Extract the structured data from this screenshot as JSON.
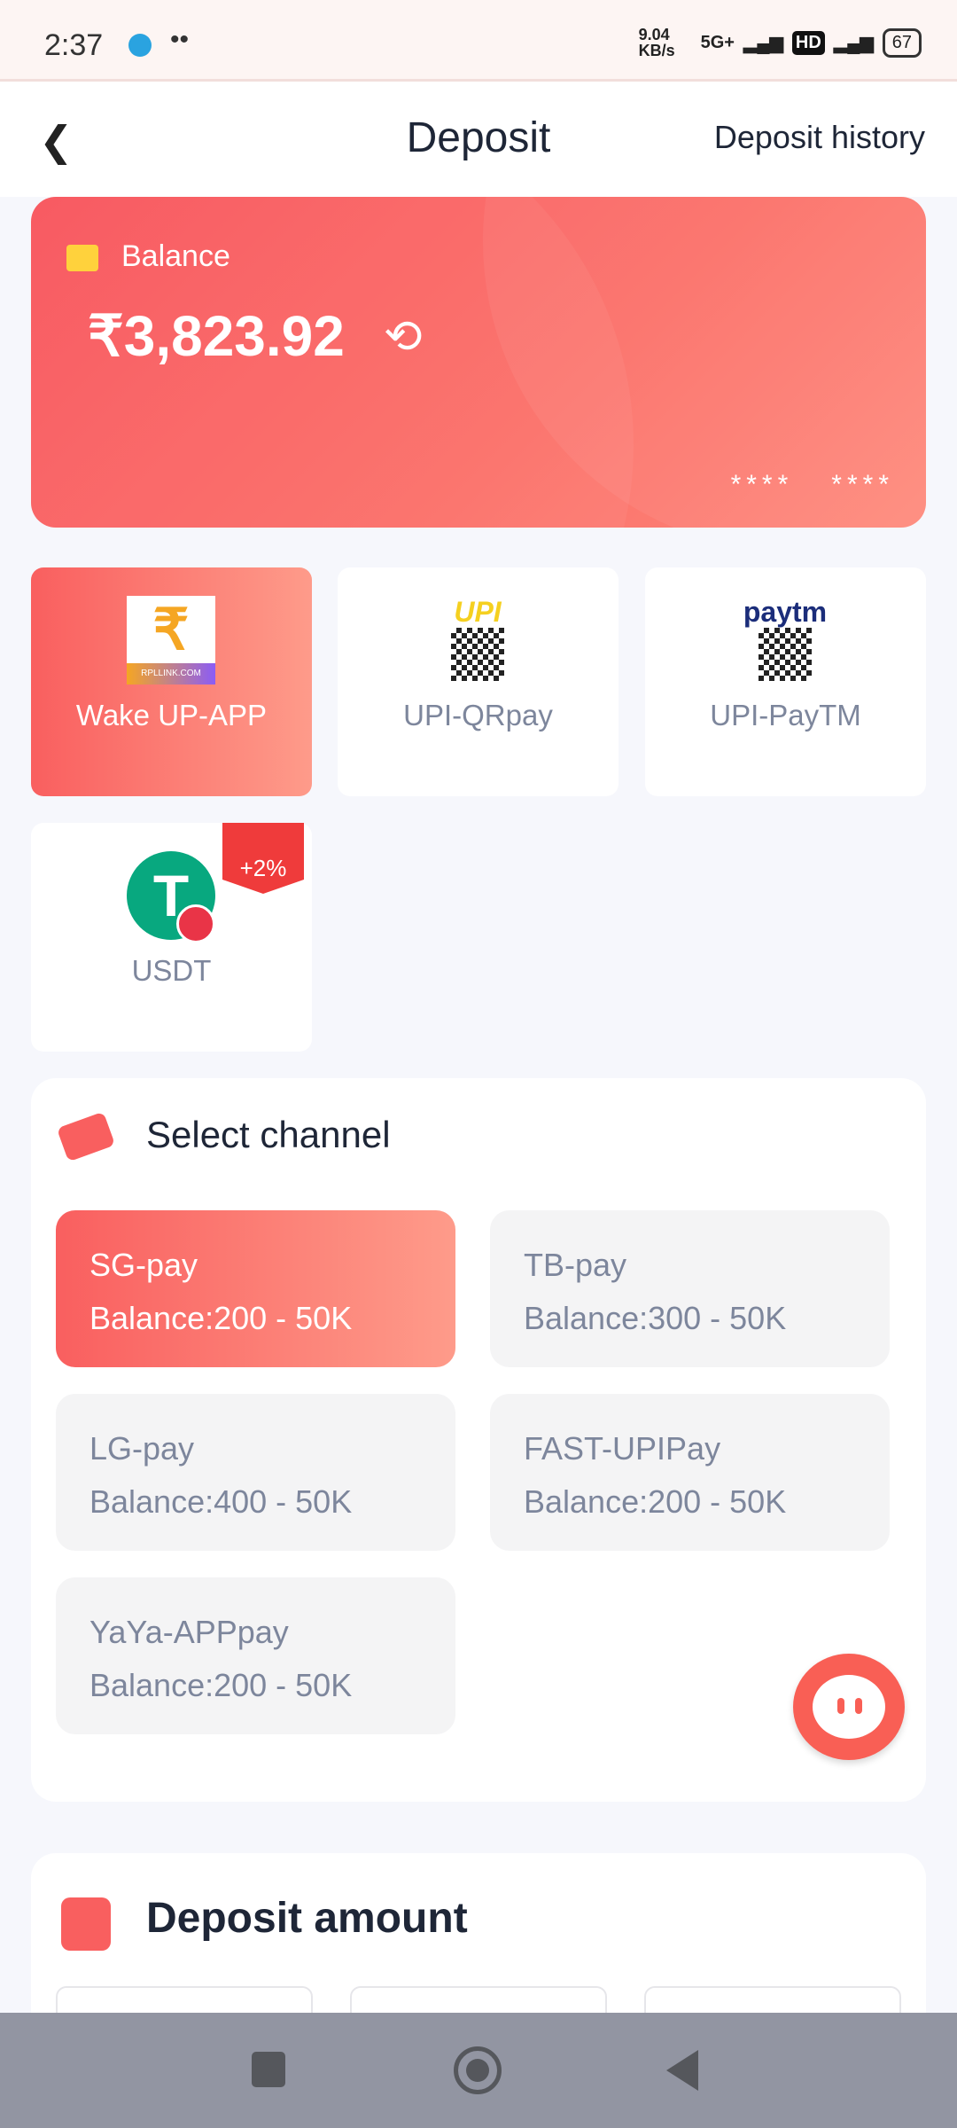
{
  "status_bar": {
    "time": "2:37",
    "net_speed": "9.04 KB/s",
    "network": "5G+",
    "hd": "HD",
    "battery": "67"
  },
  "header": {
    "title": "Deposit",
    "history_label": "Deposit history"
  },
  "balance": {
    "label": "Balance",
    "amount": "₹3,823.92",
    "masked_left": "****",
    "masked_right": "****"
  },
  "methods": [
    {
      "label": "Wake UP-APP",
      "logo_text": "RPLLINK.COM",
      "active": true
    },
    {
      "label": "UPI-QRpay",
      "logo_text": "UPI"
    },
    {
      "label": "UPI-PayTM",
      "logo_text": "paytm"
    },
    {
      "label": "USDT",
      "badge": "+2%"
    }
  ],
  "channel": {
    "title": "Select channel",
    "items": [
      {
        "name": "SG-pay",
        "range": "Balance:200 - 50K",
        "active": true
      },
      {
        "name": "TB-pay",
        "range": "Balance:300 - 50K"
      },
      {
        "name": "LG-pay",
        "range": "Balance:400 - 50K"
      },
      {
        "name": "FAST-UPIPay",
        "range": "Balance:200 - 50K"
      },
      {
        "name": "YaYa-APPpay",
        "range": "Balance:200 - 50K"
      }
    ]
  },
  "deposit_amount": {
    "title": "Deposit amount"
  }
}
